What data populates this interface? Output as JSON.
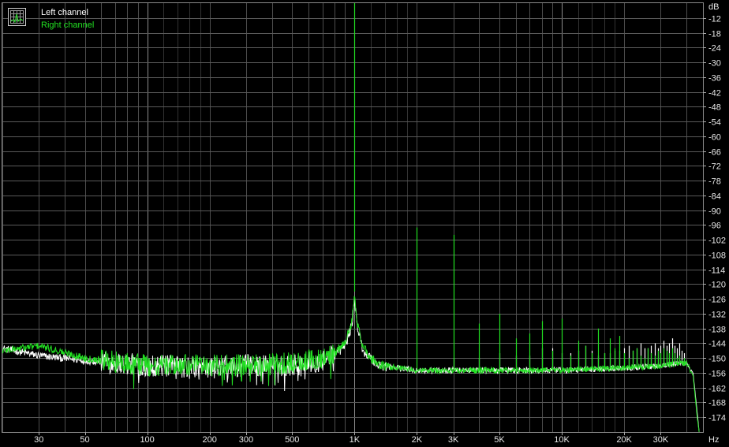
{
  "chart_data": {
    "type": "line",
    "x_unit": "Hz",
    "y_unit": "dB",
    "x_scale": "log",
    "xlim": [
      20,
      48000
    ],
    "ylim": [
      -180,
      -6
    ],
    "grid": true,
    "legend_position": "top-left",
    "x_ticks": [
      {
        "value": 30,
        "label": "30"
      },
      {
        "value": 50,
        "label": "50"
      },
      {
        "value": 100,
        "label": "100"
      },
      {
        "value": 200,
        "label": "200"
      },
      {
        "value": 300,
        "label": "300"
      },
      {
        "value": 500,
        "label": "500"
      },
      {
        "value": 1000,
        "label": "1K"
      },
      {
        "value": 2000,
        "label": "2K"
      },
      {
        "value": 3000,
        "label": "3K"
      },
      {
        "value": 5000,
        "label": "5K"
      },
      {
        "value": 10000,
        "label": "10K"
      },
      {
        "value": 20000,
        "label": "20K"
      },
      {
        "value": 30000,
        "label": "30K"
      }
    ],
    "y_ticks": [
      -12,
      -18,
      -24,
      -30,
      -36,
      -42,
      -48,
      -54,
      -60,
      -66,
      -72,
      -78,
      -84,
      -90,
      -96,
      -102,
      -108,
      -114,
      -120,
      -126,
      -132,
      -138,
      -144,
      -150,
      -156,
      -162,
      -168,
      -174
    ],
    "series": [
      {
        "name": "Left channel",
        "color": "#ffffff",
        "noise_floor": [
          [
            20,
            -146
          ],
          [
            30,
            -149
          ],
          [
            50,
            -151
          ],
          [
            100,
            -153
          ],
          [
            200,
            -154
          ],
          [
            300,
            -153
          ],
          [
            500,
            -153
          ],
          [
            700,
            -151
          ],
          [
            800,
            -149
          ],
          [
            900,
            -145
          ],
          [
            970,
            -137
          ],
          [
            1000,
            -126
          ],
          [
            1030,
            -137
          ],
          [
            1100,
            -147
          ],
          [
            1300,
            -153
          ],
          [
            2000,
            -155
          ],
          [
            5000,
            -155
          ],
          [
            10000,
            -155
          ],
          [
            20000,
            -154
          ],
          [
            30000,
            -153
          ],
          [
            40000,
            -152
          ],
          [
            43000,
            -156
          ],
          [
            45000,
            -172
          ],
          [
            46000,
            -180
          ]
        ],
        "peaks": [
          [
            1000,
            -126
          ],
          [
            2000,
            -154
          ],
          [
            3000,
            -150
          ],
          [
            4000,
            -150
          ],
          [
            5000,
            -148
          ],
          [
            6000,
            -149
          ],
          [
            7000,
            -149
          ],
          [
            8000,
            -146
          ],
          [
            9000,
            -146
          ],
          [
            10000,
            -148
          ],
          [
            11000,
            -148
          ],
          [
            12000,
            -147
          ],
          [
            13000,
            -145
          ],
          [
            14000,
            -147
          ],
          [
            15000,
            -149
          ],
          [
            16000,
            -148
          ],
          [
            17000,
            -148
          ],
          [
            18000,
            -147
          ],
          [
            19000,
            -147
          ],
          [
            20000,
            -146
          ],
          [
            21000,
            -145
          ],
          [
            22000,
            -147
          ],
          [
            23000,
            -146
          ],
          [
            24000,
            -144
          ],
          [
            25000,
            -146
          ],
          [
            26000,
            -146
          ],
          [
            27000,
            -145
          ],
          [
            28000,
            -144
          ],
          [
            29000,
            -146
          ],
          [
            30000,
            -145
          ],
          [
            31000,
            -143
          ],
          [
            32000,
            -145
          ],
          [
            33000,
            -144
          ],
          [
            34000,
            -142
          ],
          [
            35000,
            -145
          ],
          [
            36000,
            -146
          ],
          [
            37000,
            -144
          ],
          [
            38000,
            -147
          ],
          [
            39000,
            -148
          ]
        ]
      },
      {
        "name": "Right channel",
        "color": "#22e022",
        "noise_floor": [
          [
            20,
            -147
          ],
          [
            30,
            -145
          ],
          [
            50,
            -150
          ],
          [
            100,
            -153
          ],
          [
            200,
            -153
          ],
          [
            300,
            -153
          ],
          [
            500,
            -152
          ],
          [
            700,
            -150
          ],
          [
            800,
            -148
          ],
          [
            900,
            -144
          ],
          [
            970,
            -135
          ],
          [
            1000,
            -123
          ],
          [
            1030,
            -136
          ],
          [
            1100,
            -146
          ],
          [
            1300,
            -153
          ],
          [
            2000,
            -155
          ],
          [
            5000,
            -155
          ],
          [
            10000,
            -155
          ],
          [
            20000,
            -154
          ],
          [
            30000,
            -153
          ],
          [
            40000,
            -152
          ],
          [
            43000,
            -157
          ],
          [
            45000,
            -174
          ],
          [
            46000,
            -180
          ]
        ],
        "peaks": [
          [
            1000,
            -6
          ],
          [
            2000,
            -97
          ],
          [
            3000,
            -100
          ],
          [
            4000,
            -136
          ],
          [
            5000,
            -132
          ],
          [
            6000,
            -142
          ],
          [
            7000,
            -140
          ],
          [
            8000,
            -135
          ],
          [
            9000,
            -147
          ],
          [
            10000,
            -134
          ],
          [
            11000,
            -149
          ],
          [
            12000,
            -143
          ],
          [
            13000,
            -145
          ],
          [
            14000,
            -148
          ],
          [
            15000,
            -138
          ],
          [
            16000,
            -148
          ],
          [
            17000,
            -142
          ],
          [
            18000,
            -146
          ],
          [
            19000,
            -141
          ],
          [
            20000,
            -148
          ],
          [
            21000,
            -150
          ],
          [
            22000,
            -147
          ],
          [
            23000,
            -146
          ],
          [
            24000,
            -149
          ],
          [
            25000,
            -150
          ],
          [
            26000,
            -146
          ],
          [
            27000,
            -148
          ],
          [
            28000,
            -149
          ],
          [
            29000,
            -147
          ],
          [
            30000,
            -148
          ],
          [
            31000,
            -146
          ],
          [
            32000,
            -147
          ],
          [
            33000,
            -148
          ],
          [
            34000,
            -146
          ],
          [
            35000,
            -148
          ],
          [
            36000,
            -150
          ],
          [
            37000,
            -149
          ],
          [
            38000,
            -151
          ],
          [
            39000,
            -150
          ]
        ]
      }
    ]
  }
}
